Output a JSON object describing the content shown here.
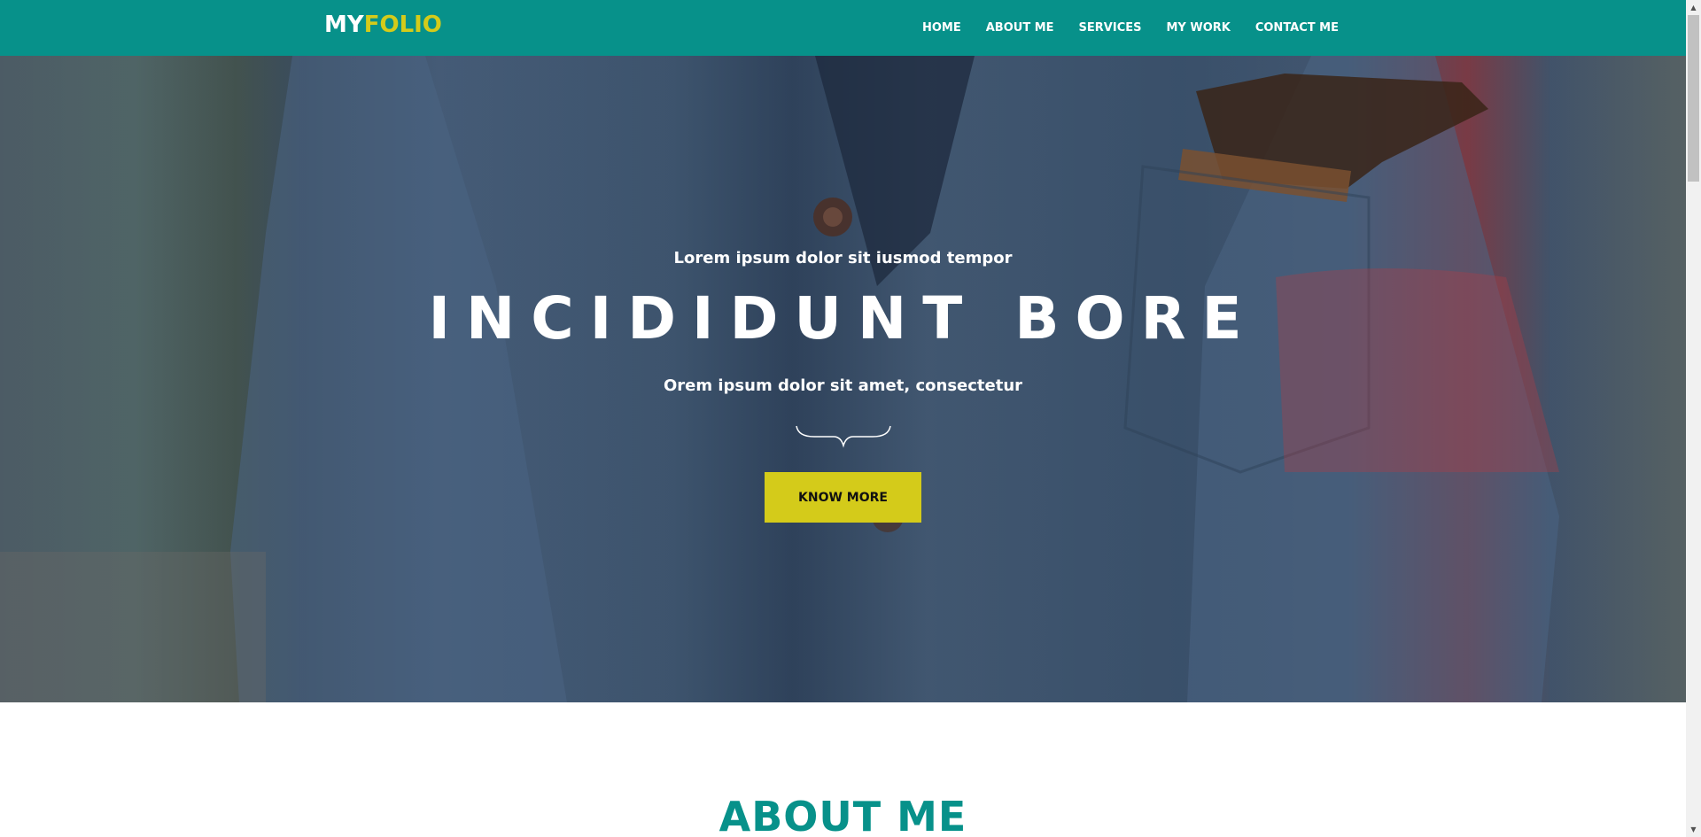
{
  "brand": {
    "part1": "MY",
    "part2": "FOLIO",
    "accent_color": "#d4cb1a",
    "nav_color": "#07918a"
  },
  "nav": {
    "items": [
      {
        "label": "HOME"
      },
      {
        "label": "ABOUT ME"
      },
      {
        "label": "SERVICES"
      },
      {
        "label": "MY WORK"
      },
      {
        "label": "CONTACT ME"
      }
    ]
  },
  "hero": {
    "kicker": "Lorem ipsum dolor sit iusmod tempor",
    "title": "INCIDIDUNT BORE",
    "subtitle": "Orem ipsum dolor sit amet, consectetur",
    "cta_label": "KNOW MORE",
    "background": "photo of a man in a blue tweed jacket",
    "divider_icon": "curly-brace-divider-icon"
  },
  "about": {
    "title": "ABOUT ME"
  },
  "scrollbar": {
    "up_icon": "scroll-up-arrow-icon",
    "down_icon": "scroll-down-arrow-icon"
  }
}
